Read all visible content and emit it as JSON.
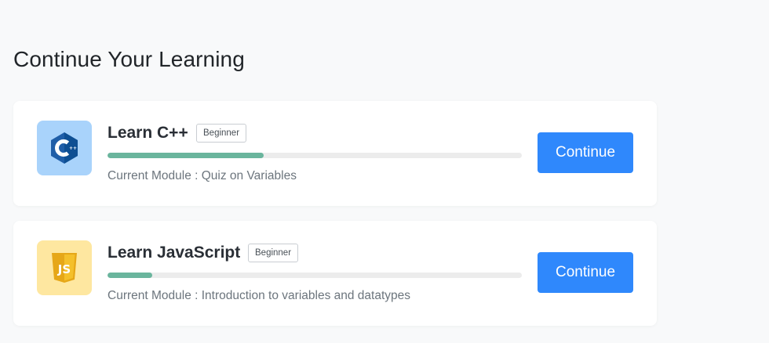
{
  "section": {
    "title": "Continue Your Learning"
  },
  "courses": [
    {
      "title": "Learn C++",
      "level": "Beginner",
      "progress_fraction": 0.376,
      "module_label": "Current Module : Quiz on Variables",
      "button_label": "Continue",
      "icon": "cpp-logo-icon",
      "icon_bg": "#a9d3fb"
    },
    {
      "title": "Learn JavaScript",
      "level": "Beginner",
      "progress_fraction": 0.108,
      "module_label": "Current Module : Introduction to variables and datatypes",
      "button_label": "Continue",
      "icon": "js-logo-icon",
      "icon_bg": "#fee7a0"
    }
  ],
  "colors": {
    "accent": "#2f88fc",
    "progress": "#6ab59d",
    "progress_track": "#ececec"
  }
}
